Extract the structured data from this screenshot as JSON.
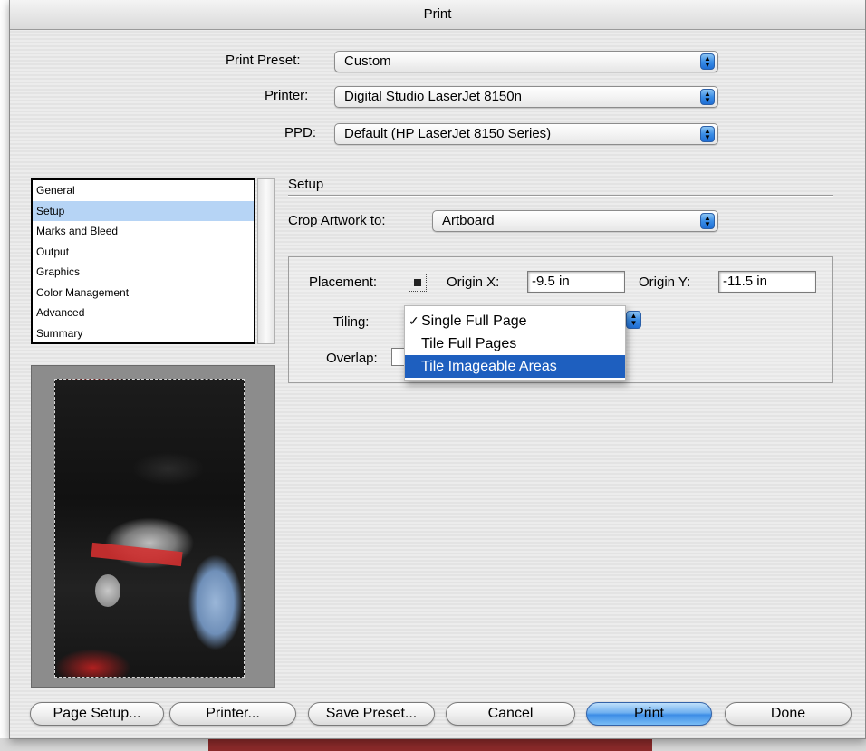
{
  "window": {
    "title": "Print"
  },
  "top": {
    "print_preset_label": "Print Preset:",
    "print_preset_value": "Custom",
    "printer_label": "Printer:",
    "printer_value": "Digital Studio LaserJet 8150n",
    "ppd_label": "PPD:",
    "ppd_value": "Default (HP LaserJet 8150 Series)"
  },
  "sidebar": {
    "items": [
      {
        "label": "General"
      },
      {
        "label": "Setup"
      },
      {
        "label": "Marks and Bleed"
      },
      {
        "label": "Output"
      },
      {
        "label": "Graphics"
      },
      {
        "label": "Color Management"
      },
      {
        "label": "Advanced"
      },
      {
        "label": "Summary"
      }
    ],
    "selected": "Setup"
  },
  "setup": {
    "title": "Setup",
    "crop_label": "Crop Artwork to:",
    "crop_value": "Artboard",
    "placement_label": "Placement:",
    "origin_x_label": "Origin X:",
    "origin_x_value": "-9.5 in",
    "origin_y_label": "Origin Y:",
    "origin_y_value": "-11.5 in",
    "tiling_label": "Tiling:",
    "overlap_label": "Overlap:"
  },
  "tiling_menu": {
    "options": [
      {
        "label": "Single Full Page",
        "checked": true
      },
      {
        "label": "Tile Full Pages",
        "checked": false
      },
      {
        "label": "Tile Imageable Areas",
        "highlighted": true
      }
    ],
    "check_glyph": "✓"
  },
  "buttons": {
    "page_setup": "Page Setup...",
    "printer": "Printer...",
    "save_preset": "Save Preset...",
    "cancel": "Cancel",
    "print": "Print",
    "done": "Done"
  },
  "colors": {
    "accent": "#3d8de6",
    "menu_highlight": "#1e5fbf",
    "list_selection": "#b6d4f5"
  }
}
